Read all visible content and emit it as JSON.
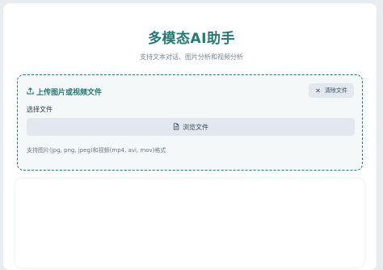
{
  "header": {
    "title": "多模态AI助手",
    "subtitle": "支持文本对话、图片分析和视频分析"
  },
  "upload": {
    "heading": "上传图片或视频文件",
    "heading_icon": "upload-icon",
    "clear_label": "清除文件",
    "clear_icon": "close-icon",
    "choose_label": "选择文件",
    "browse_label": "浏览文件",
    "browse_icon": "file-icon",
    "hint": "支持图片(jpg, png, jpeg)和视频(mp4, avi, mov)格式"
  },
  "colors": {
    "accent": "#237a73",
    "background": "#e9edf1",
    "button_bg": "#e2e8ee"
  }
}
